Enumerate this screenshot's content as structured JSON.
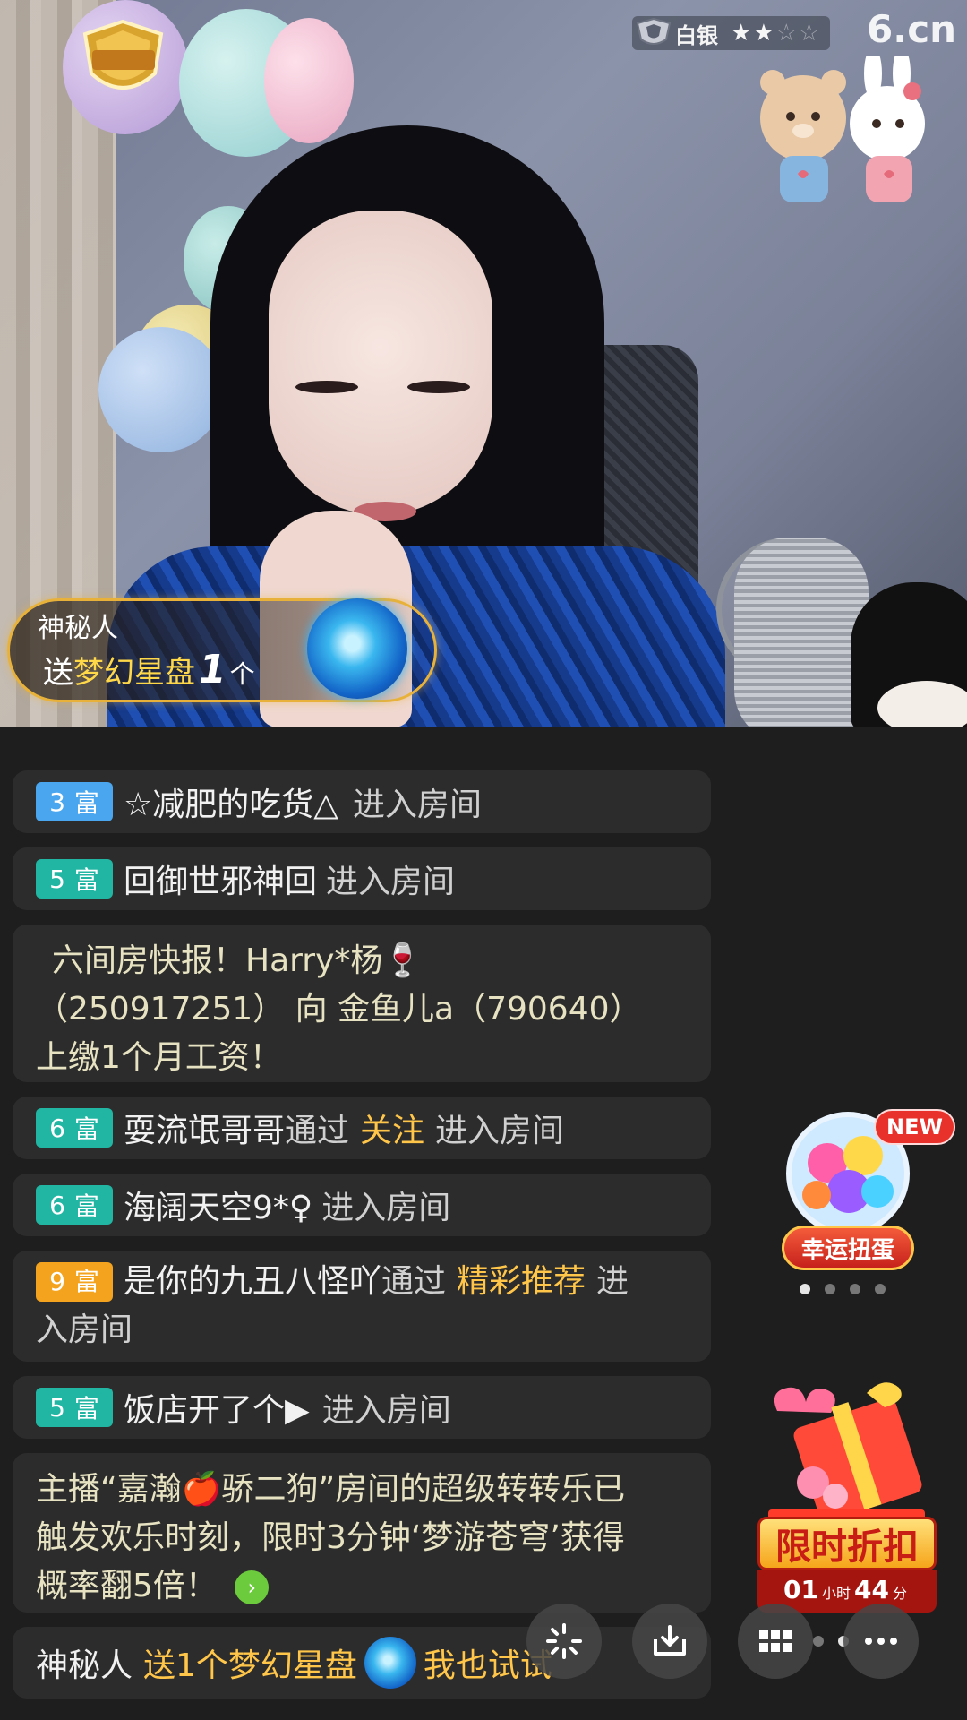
{
  "video": {
    "tier_label": "白银",
    "stars_on": "★★",
    "stars_off": "☆☆",
    "logo_text": "6.cn",
    "gift_notice": {
      "user": "神秘人",
      "prefix": "送",
      "gift_name": "梦幻星盘",
      "count": "1",
      "unit": "个"
    }
  },
  "chat": {
    "messages": [
      {
        "level": "3",
        "rank": "富",
        "user": "☆减肥的吃货△",
        "action": "进入房间"
      },
      {
        "level": "5",
        "rank": "富",
        "user": "回御世邪神回",
        "action": "进入房间"
      },
      {
        "text_line1": "六间房快报！Harry*杨🍷",
        "text_line2": "（250917251） 向  金鱼儿a（790640）",
        "text_line3": "上缴1个月工资！"
      },
      {
        "level": "6",
        "rank": "富",
        "user": "耍流氓哥哥",
        "via": "通过",
        "source": "关注",
        "action": "进入房间"
      },
      {
        "level": "6",
        "rank": "富",
        "user": "海阔天空9*♀",
        "action": "进入房间"
      },
      {
        "level": "9",
        "rank": "富",
        "user": "是你的九丑八怪吖",
        "via": "通过",
        "source": "精彩推荐",
        "action_part1": "进",
        "action_part2": "入房间"
      },
      {
        "level": "5",
        "rank": "富",
        "user": "饭店开了个▶",
        "action": "进入房间"
      },
      {
        "line1": "主播“嘉瀚🍎骄二狗”房间的超级转转乐已",
        "line2": "触发欢乐时刻，限时3分钟‘梦游苍穹’获得",
        "line3": "概率翻5倍！"
      },
      {
        "user": "神秘人",
        "gift": "送1个梦幻星盘",
        "cta": "我也试试"
      }
    ]
  },
  "widgets": {
    "gacha_new": "NEW",
    "gacha_label": "幸运扭蛋",
    "sale_title": "限时折扣",
    "sale_hours": "01",
    "sale_hours_unit": "小时",
    "sale_minutes": "44",
    "sale_minutes_unit": "分"
  },
  "colors": {
    "badge_blue": "#4aa6ee",
    "badge_teal": "#21b6a3",
    "badge_gold": "#f3a31d",
    "highlight": "#ffc64a"
  },
  "icons": [
    "guard-badge-icon",
    "silver-tier-icon",
    "sticker-bear-rabbit-icon",
    "gift-orb-icon",
    "gacha-machine-icon",
    "discount-gift-box-icon",
    "sparkle-icon",
    "download-icon",
    "grid-icon",
    "more-icon"
  ]
}
